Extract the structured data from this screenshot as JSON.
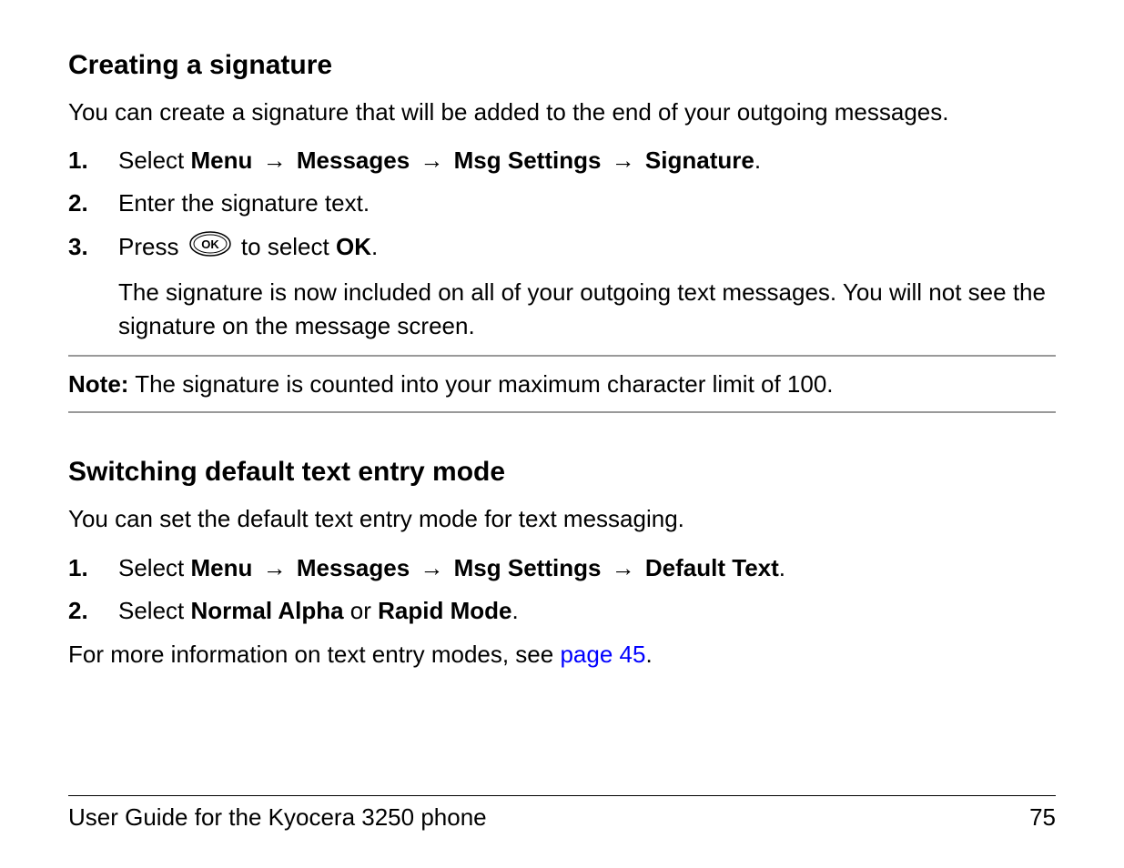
{
  "section1": {
    "heading": "Creating a signature",
    "intro": "You can create a signature that will be added to the end of your outgoing messages.",
    "steps": {
      "1": {
        "num": "1.",
        "select": "Select ",
        "menu": "Menu",
        "messages": "Messages",
        "msg_settings": "Msg Settings",
        "signature": "Signature",
        "period": "."
      },
      "2": {
        "num": "2.",
        "text": "Enter the signature text."
      },
      "3": {
        "num": "3.",
        "press": "Press ",
        "to_select": " to select ",
        "ok": "OK",
        "period": ".",
        "sub": "The signature is now included on all of your outgoing text messages. You will not see the signature on the message screen."
      }
    },
    "note": {
      "label": "Note:",
      "text": " The signature is counted into your maximum character limit of 100."
    }
  },
  "section2": {
    "heading": "Switching default text entry mode",
    "intro": "You can set the default text entry mode for text messaging.",
    "steps": {
      "1": {
        "num": "1.",
        "select": "Select ",
        "menu": "Menu",
        "messages": "Messages",
        "msg_settings": "Msg Settings",
        "default_text": "Default Text",
        "period": "."
      },
      "2": {
        "num": "2.",
        "select": "Select ",
        "normal_alpha": "Normal Alpha",
        "or": " or ",
        "rapid_mode": "Rapid Mode",
        "period": "."
      }
    },
    "more_info": {
      "prefix": "For more information on text entry modes, see ",
      "link": "page 45",
      "period": "."
    }
  },
  "footer": {
    "guide": "User Guide for the Kyocera 3250 phone",
    "page": "75"
  },
  "arrow": "→"
}
